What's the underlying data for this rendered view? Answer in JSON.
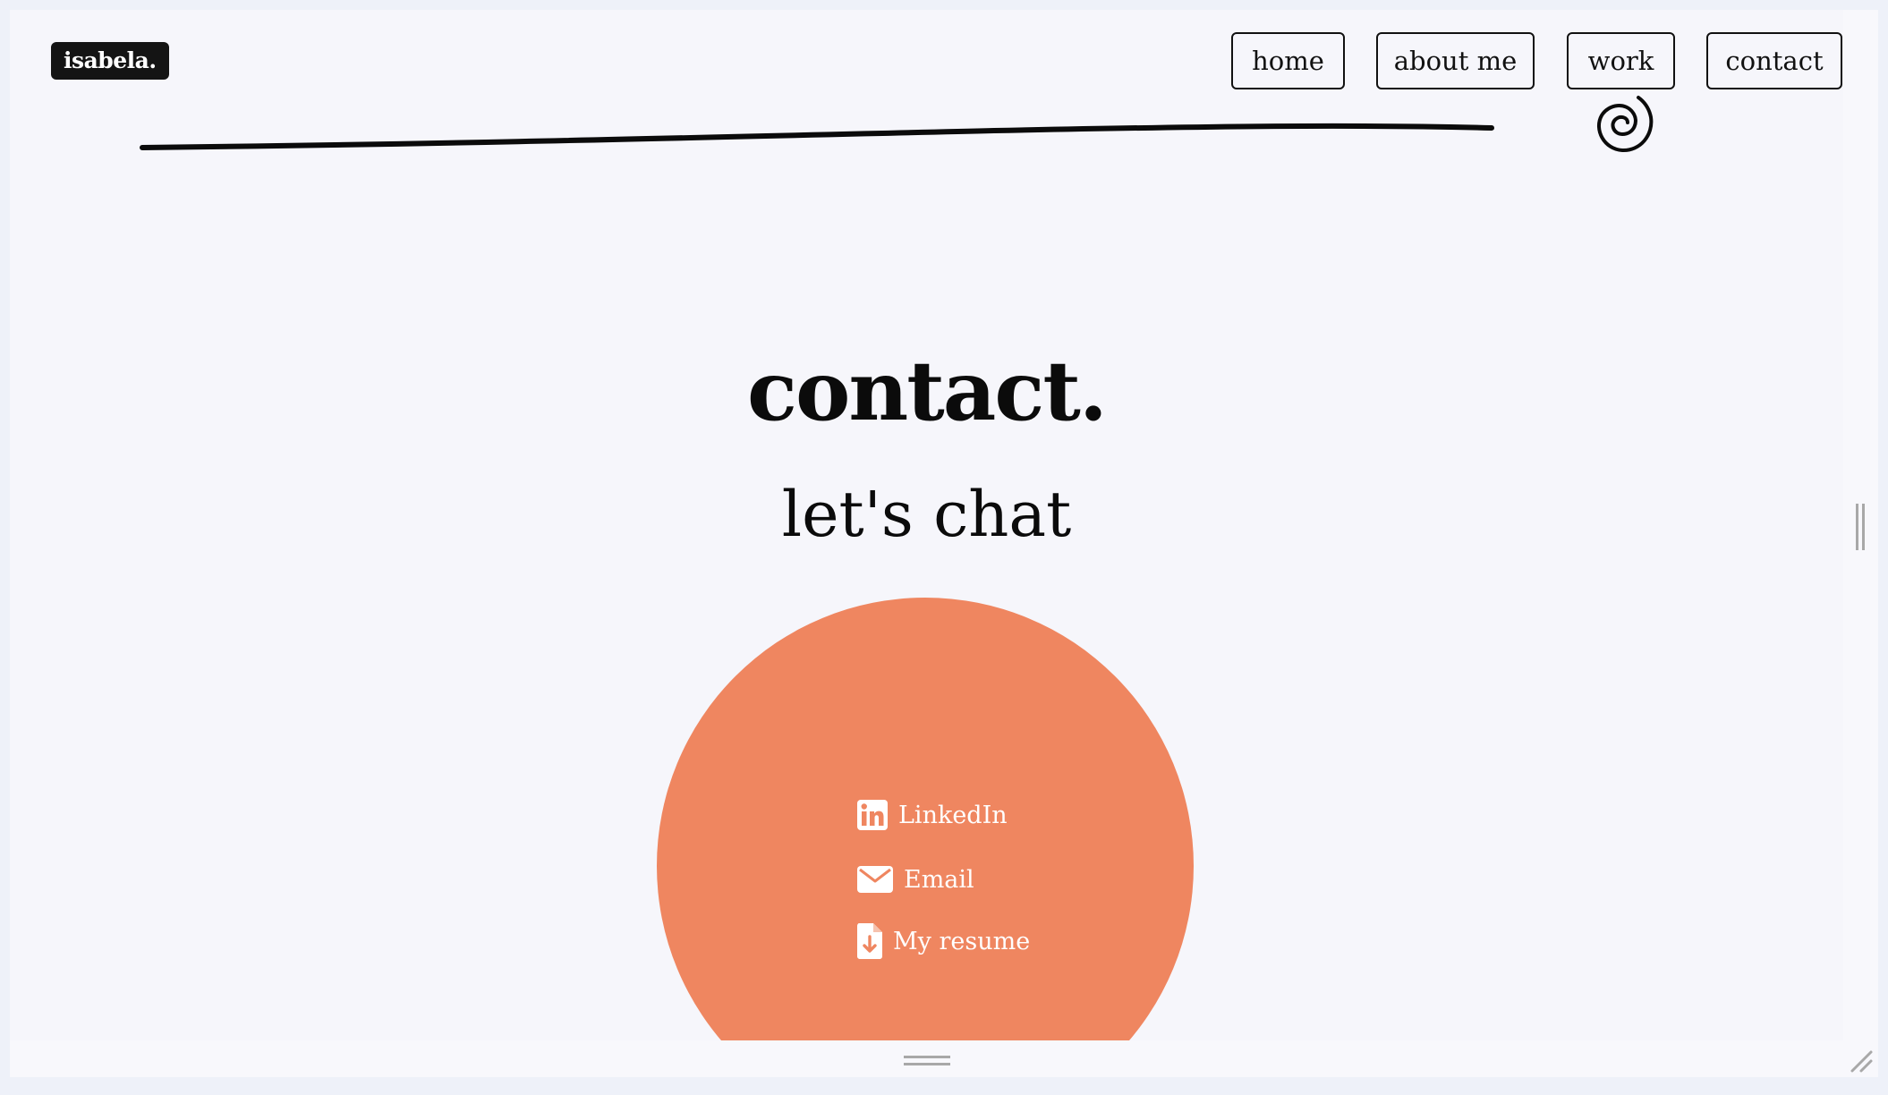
{
  "header": {
    "logo_text": "isabela."
  },
  "nav": {
    "items": [
      {
        "label": "home"
      },
      {
        "label": "about me"
      },
      {
        "label": "work"
      },
      {
        "label": "contact"
      }
    ]
  },
  "main": {
    "title": "contact.",
    "subtitle": "let's chat"
  },
  "contact_links": [
    {
      "label": "LinkedIn",
      "icon": "linkedin-icon"
    },
    {
      "label": "Email",
      "icon": "envelope-icon"
    },
    {
      "label": "My resume",
      "icon": "file-download-icon"
    }
  ],
  "colors": {
    "accent": "#ef8660",
    "page_background": "#f6f6fb",
    "text": "#0b0b0b"
  }
}
